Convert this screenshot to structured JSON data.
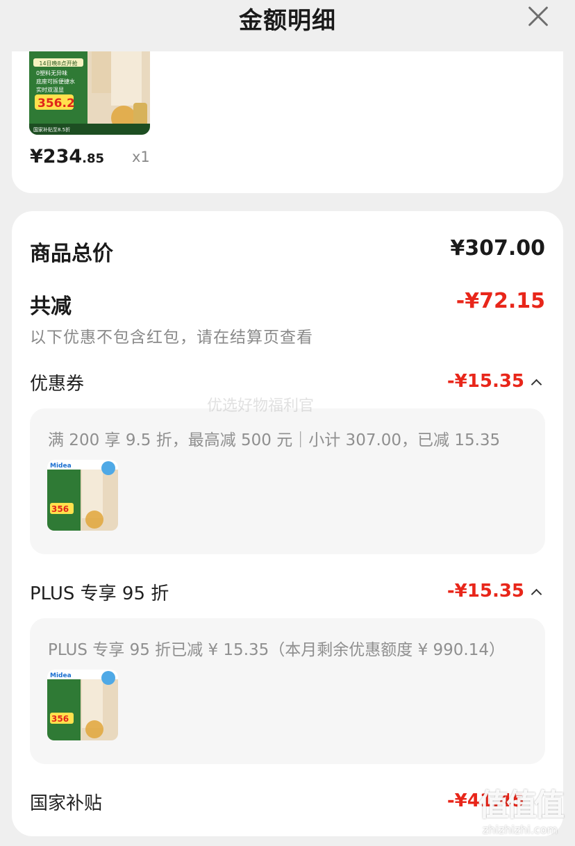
{
  "header": {
    "title": "金额明细"
  },
  "product": {
    "price_symbol": "¥",
    "price_integer": "234",
    "price_decimal": ".85",
    "quantity": "x1",
    "thumb": {
      "badge_text": "14日晚8点开抢",
      "features": [
        "0塑料无异味",
        "底座可拆便捷水",
        "实时双温显"
      ],
      "promo_price": "356.2",
      "footer": "国家补贴至8.5折"
    }
  },
  "summary": {
    "total_label": "商品总价",
    "total_value": "¥307.00",
    "discount_label": "共减",
    "discount_value": "-¥72.15",
    "discount_note": "以下优惠不包含红包，请在结算页查看"
  },
  "coupon": {
    "label": "优惠券",
    "amount": "-¥15.35",
    "detail": "满 200 享 9.5 折，最高减 500 元｜小计 307.00，已减 15.35",
    "thumb": {
      "brand": "Midea",
      "promo_price": "356"
    }
  },
  "plus": {
    "label": "PLUS 专享 95 折",
    "amount": "-¥15.35",
    "detail": "PLUS 专享 95 折已减 ¥ 15.35（本月剩余优惠额度 ¥ 990.14）",
    "thumb": {
      "brand": "Midea",
      "promo_price": "356"
    }
  },
  "subsidy": {
    "label": "国家补贴",
    "amount": "-¥41.45"
  },
  "watermarks": {
    "center": "优选好物福利官",
    "corner_logo": "值值值",
    "corner_site": "zhizhizhi.com"
  },
  "colors": {
    "accent_red": "#e8261a",
    "card_bg": "#ffffff",
    "page_bg": "#efefef",
    "detail_bg": "#f6f6f6"
  }
}
